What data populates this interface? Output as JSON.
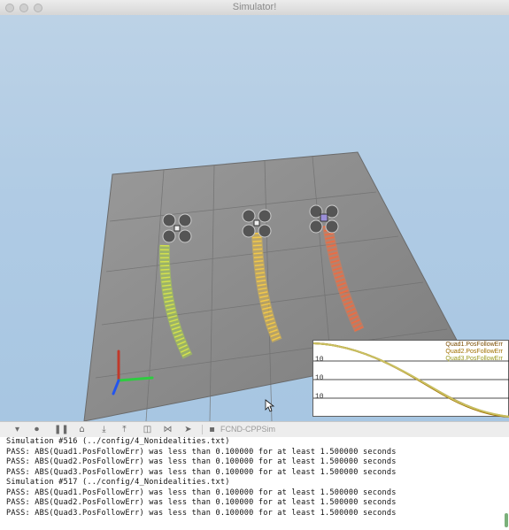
{
  "window": {
    "title": "Simulator!"
  },
  "plot": {
    "legend": [
      "Quad1.PosFollowErr",
      "Quad2.PosFollowErr",
      "Quad3.PosFollowErr"
    ],
    "legend_colors": [
      "#7a4b00",
      "#a07000",
      "#9a9a20"
    ],
    "yticks": [
      "10",
      "10",
      "10"
    ]
  },
  "toolbar": {
    "icons": [
      "dropdown-icon",
      "record-icon",
      "pause-icon",
      "home-icon",
      "step-down-icon",
      "step-up-icon",
      "graph-icon",
      "share-icon",
      "send-icon",
      "terminal-icon"
    ],
    "target": "FCND-CPPSim"
  },
  "console": {
    "lines": [
      "Simulation #516 (../config/4_Nonidealities.txt)",
      "PASS: ABS(Quad1.PosFollowErr) was less than 0.100000 for at least 1.500000 seconds",
      "PASS: ABS(Quad2.PosFollowErr) was less than 0.100000 for at least 1.500000 seconds",
      "PASS: ABS(Quad3.PosFollowErr) was less than 0.100000 for at least 1.500000 seconds",
      "Simulation #517 (../config/4_Nonidealities.txt)",
      "PASS: ABS(Quad1.PosFollowErr) was less than 0.100000 for at least 1.500000 seconds",
      "PASS: ABS(Quad2.PosFollowErr) was less than 0.100000 for at least 1.500000 seconds",
      "PASS: ABS(Quad3.PosFollowErr) was less than 0.100000 for at least 1.500000 seconds"
    ]
  }
}
